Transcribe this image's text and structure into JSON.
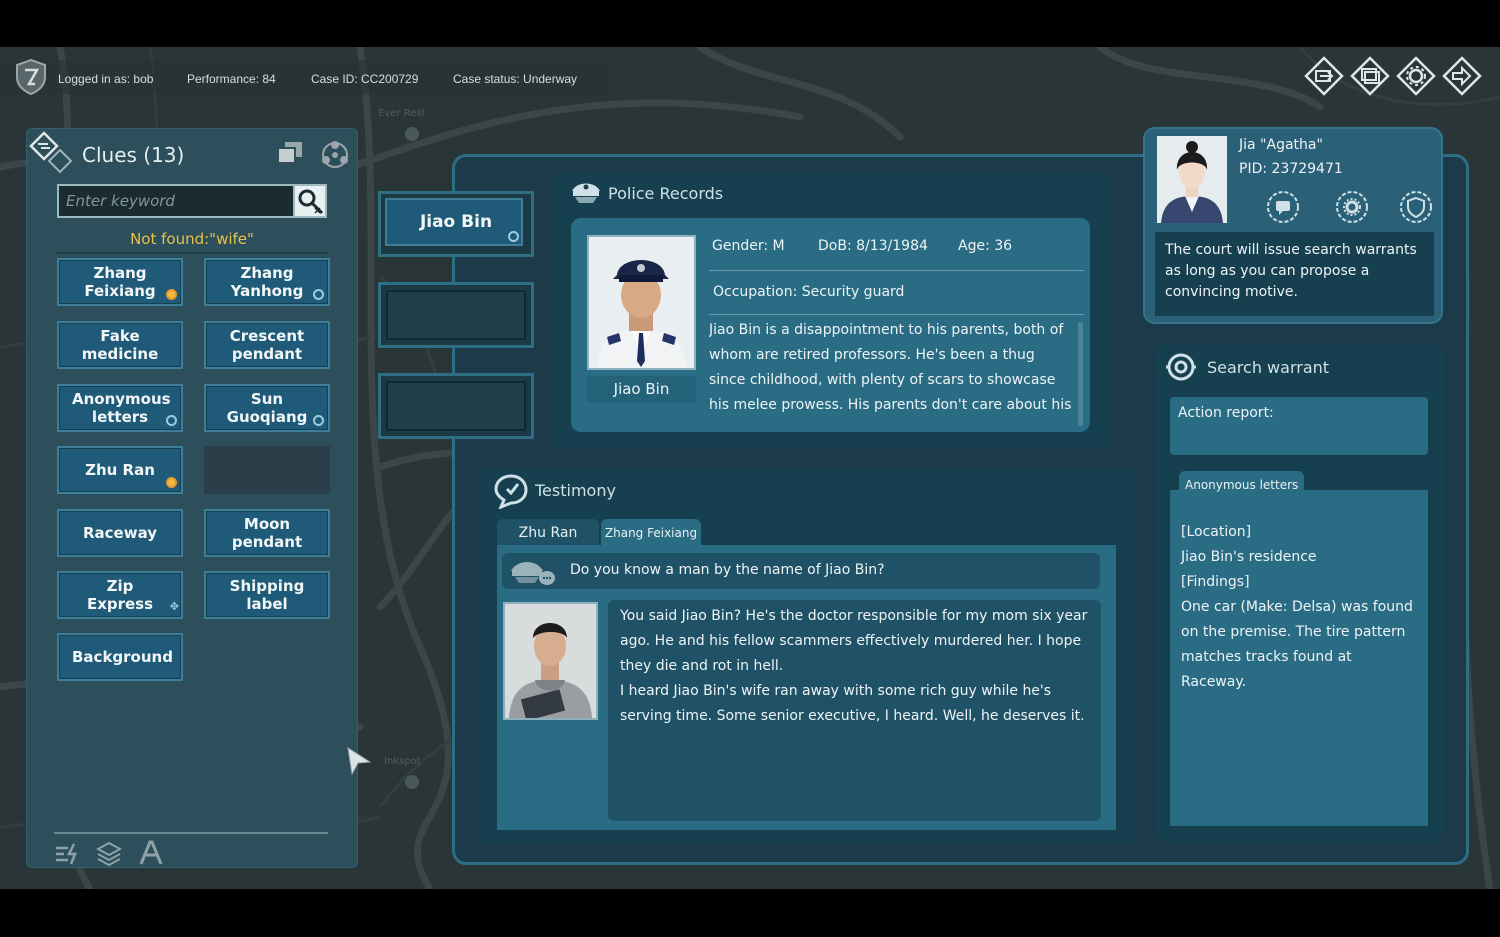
{
  "status_bar": {
    "logged_in": "Logged in as: bob",
    "performance": "Performance: 84",
    "case_id": "Case ID: CC200729",
    "case_status": "Case status: Underway"
  },
  "top_icons": [
    "export-icon",
    "window-icon",
    "settings-icon",
    "exit-icon"
  ],
  "map_labels": {
    "top": "Ever Rest",
    "bottom": "Inkspot"
  },
  "clues": {
    "title": "Clues",
    "count": "(13)",
    "search_placeholder": "Enter keyword",
    "not_found": "Not found:\"wife\"",
    "items": [
      {
        "label": "Zhang Feixiang",
        "badge": "orange"
      },
      {
        "label": "Zhang Yanhong",
        "badge": "blue"
      },
      {
        "label": "Fake medicine",
        "badge": ""
      },
      {
        "label": "Crescent pendant",
        "badge": ""
      },
      {
        "label": "Anonymous letters",
        "badge": "blue"
      },
      {
        "label": "Sun Guoqiang",
        "badge": "blue"
      },
      {
        "label": "Zhu Ran",
        "badge": "orange"
      },
      {
        "label": "",
        "badge": ""
      },
      {
        "label": "Raceway",
        "badge": ""
      },
      {
        "label": "Moon pendant",
        "badge": ""
      },
      {
        "label": "Zip Express",
        "badge": ""
      },
      {
        "label": "Shipping label",
        "badge": ""
      },
      {
        "label": "Background",
        "badge": ""
      }
    ]
  },
  "suspects": {
    "tabs": [
      {
        "label": "Jiao Bin",
        "active": true
      },
      {
        "label": "",
        "active": false
      },
      {
        "label": "",
        "active": false
      }
    ]
  },
  "police_records": {
    "title": "Police Records",
    "photo_name": "Jiao Bin",
    "gender": "Gender: M",
    "dob": "DoB: 8/13/1984",
    "age": "Age: 36",
    "occupation": "Occupation: Security guard",
    "description": "Jiao Bin is a disappointment to his parents, both of whom are retired professors. He's been a thug since childhood, with plenty of scars to showcase his melee prowess. His parents don't care about his"
  },
  "testimony": {
    "title": "Testimony",
    "tabs": [
      {
        "label": "Zhu Ran",
        "active": false
      },
      {
        "label": "Zhang Feixiang",
        "active": true
      }
    ],
    "question": "Do you know a man by the name of Jiao Bin?",
    "answer_1": "You said Jiao Bin? He's the doctor responsible for my mom six year ago. He and his fellow scammers effectively murdered her. I hope they die and rot in hell.",
    "answer_2": "I heard Jiao Bin's wife ran away with some rich guy while he's serving time. Some senior executive, I heard. Well, he deserves it."
  },
  "partner": {
    "name": "Jia \"Agatha\"",
    "pid": "PID: 23729471",
    "message": "The court will issue search warrants as long as you can propose a convincing motive."
  },
  "search_warrant": {
    "title": "Search warrant",
    "action_label": "Action report:",
    "tab": "Anonymous letters",
    "lines": [
      "[Location]",
      "Jiao Bin's residence",
      "[Findings]",
      "One car (Make: Delsa) was found on the premise. The tire pattern matches tracks found at Raceway."
    ]
  },
  "colors": {
    "accent": "#1f5b78",
    "panel": "#16404f",
    "card": "#2a6c84",
    "warning_text": "#e7c24a",
    "badge_orange": "#f3b74a"
  }
}
